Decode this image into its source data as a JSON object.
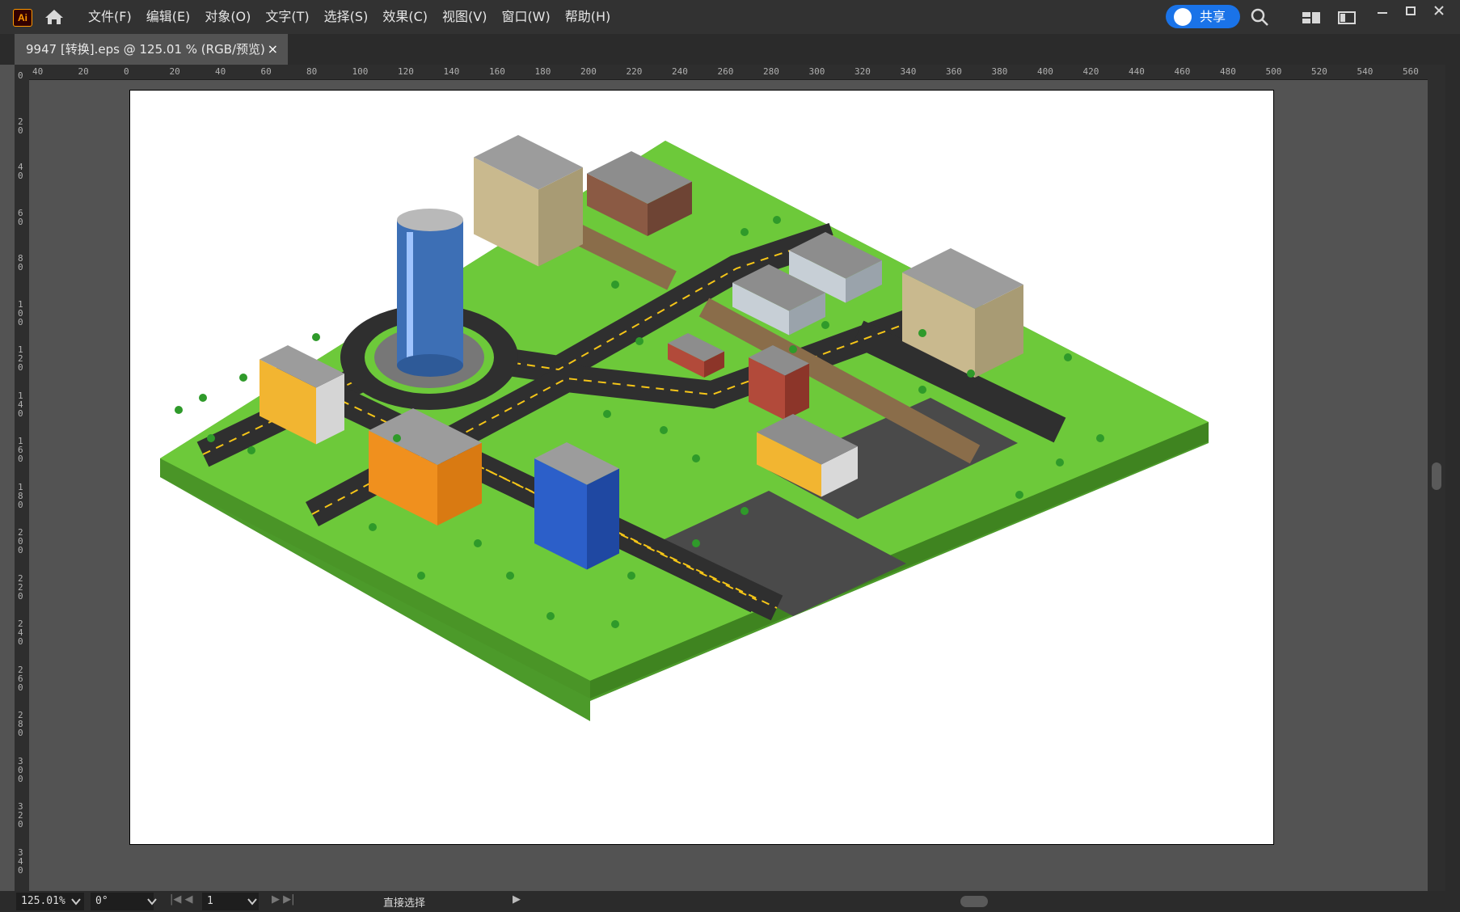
{
  "app": {
    "logo_text": "Ai",
    "brand_color": "#ff9a00"
  },
  "menu": {
    "items": [
      "文件(F)",
      "编辑(E)",
      "对象(O)",
      "文字(T)",
      "选择(S)",
      "效果(C)",
      "视图(V)",
      "窗口(W)",
      "帮助(H)"
    ]
  },
  "share": {
    "label": "共享",
    "color": "#1a73e8"
  },
  "icons": {
    "home": "home-icon",
    "search": "search-icon",
    "layout": "layout-icon",
    "panel": "panel-icon"
  },
  "tab": {
    "title": "9947 [转换].eps @ 125.01 % (RGB/预览)",
    "close": "×"
  },
  "ruler_h": [
    "40",
    "20",
    "0",
    "20",
    "40",
    "60",
    "80",
    "100",
    "120",
    "140",
    "160",
    "180",
    "200",
    "220",
    "240",
    "260",
    "280",
    "300",
    "320",
    "340",
    "360",
    "380",
    "400",
    "420",
    "440",
    "460",
    "480",
    "500",
    "520",
    "540",
    "560"
  ],
  "ruler_v": [
    "0",
    "20",
    "40",
    "60",
    "80",
    "100",
    "120",
    "140",
    "160",
    "180",
    "200",
    "220",
    "240",
    "260",
    "280",
    "300",
    "320",
    "340"
  ],
  "status": {
    "zoom": "125.01%",
    "rotate": "0°",
    "artboard": "1",
    "tool": "直接选择"
  }
}
